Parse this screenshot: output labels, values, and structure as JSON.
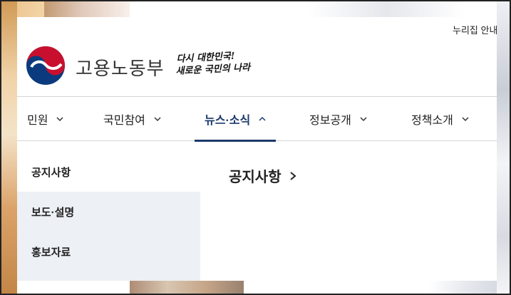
{
  "header": {
    "utility_link": "누리집 안내",
    "ministry_name": "고용노동부",
    "slogan_line1": "다시 대한민국!",
    "slogan_line2": "새로운 국민의 나라"
  },
  "nav": {
    "items": [
      {
        "label": "민원",
        "state": "collapsed"
      },
      {
        "label": "국민참여",
        "state": "collapsed"
      },
      {
        "label": "뉴스·소식",
        "state": "expanded"
      },
      {
        "label": "정보공개",
        "state": "collapsed"
      },
      {
        "label": "정책소개",
        "state": "collapsed"
      }
    ]
  },
  "submenu": {
    "items": [
      {
        "label": "공지사항"
      },
      {
        "label": "보도·설명"
      },
      {
        "label": "홍보자료"
      }
    ]
  },
  "content": {
    "link_label": "공지사항"
  },
  "colors": {
    "accent": "#1b3a6b",
    "logo_red": "#c8102e",
    "logo_blue": "#0b3a7e",
    "submenu_bg": "#edf0f4"
  }
}
